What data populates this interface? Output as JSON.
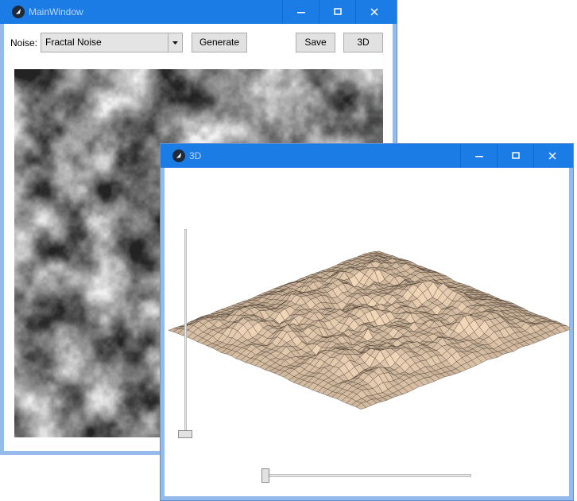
{
  "main_window": {
    "title": "MainWindow",
    "noise_label": "Noise:",
    "noise_select_value": "Fractal Noise",
    "generate_label": "Generate",
    "save_label": "Save",
    "view3d_label": "3D"
  },
  "window_3d": {
    "title": "3D"
  },
  "colors": {
    "titlebar": "#1c7ce6",
    "terrain_fill": "#f2d6b8",
    "terrain_line": "#3b2e22"
  }
}
